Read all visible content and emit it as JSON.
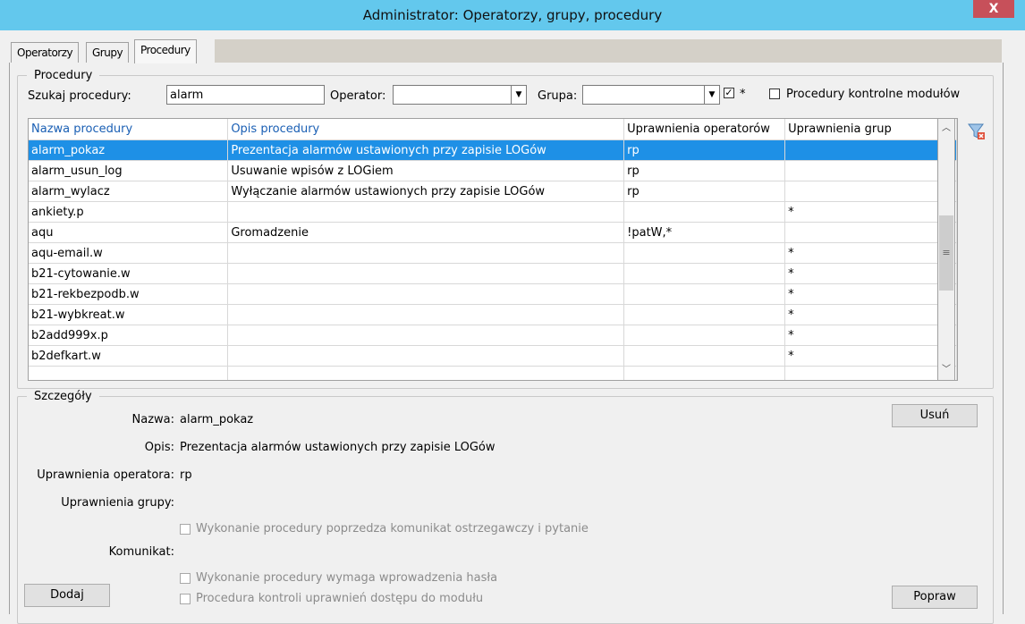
{
  "window": {
    "title": "Administrator: Operatorzy, grupy, procedury",
    "close_label": "X"
  },
  "tabs": [
    {
      "label": "Operatorzy",
      "active": false
    },
    {
      "label": "Grupy",
      "active": false
    },
    {
      "label": "Procedury",
      "active": true
    }
  ],
  "procedures": {
    "legend": "Procedury",
    "search_label": "Szukaj procedury:",
    "search_value": "alarm",
    "operator_label": "Operator:",
    "operator_value": "",
    "group_label": "Grupa:",
    "group_value": "",
    "star_checkbox_checked": true,
    "star_label": "*",
    "control_checkbox_checked": false,
    "control_label": "Procedury kontrolne modułów",
    "columns": [
      "Nazwa procedury",
      "Opis procedury",
      "Uprawnienia operatorów",
      "Uprawnienia grup"
    ],
    "rows": [
      [
        "alarm_pokaz",
        "Prezentacja alarmów ustawionych przy zapisie LOGów",
        "rp",
        ""
      ],
      [
        "alarm_usun_log",
        "Usuwanie wpisów z LOGiem",
        "rp",
        ""
      ],
      [
        "alarm_wylacz",
        "Wyłączanie alarmów ustawionych przy zapisie LOGów",
        "rp",
        ""
      ],
      [
        "ankiety.p",
        "",
        "",
        "*"
      ],
      [
        "aqu",
        "Gromadzenie",
        "!patW,*",
        ""
      ],
      [
        "aqu-email.w",
        "",
        "",
        "*"
      ],
      [
        "b21-cytowanie.w",
        "",
        "",
        "*"
      ],
      [
        "b21-rekbezpodb.w",
        "",
        "",
        "*"
      ],
      [
        "b21-wybkreat.w",
        "",
        "",
        "*"
      ],
      [
        "b2add999x.p",
        "",
        "",
        "*"
      ],
      [
        "b2defkart.w",
        "",
        "",
        "*"
      ],
      [
        "",
        "",
        "",
        ""
      ]
    ],
    "selected_row": 0
  },
  "details": {
    "legend": "Szczegóły",
    "name_label": "Nazwa:",
    "name_value": "alarm_pokaz",
    "desc_label": "Opis:",
    "desc_value": "Prezentacja alarmów ustawionych przy zapisie LOGów",
    "op_rights_label": "Uprawnienia operatora:",
    "op_rights_value": "rp",
    "group_rights_label": "Uprawnienia grupy:",
    "group_rights_value": "",
    "warn_check_label": "Wykonanie procedury poprzedza komunikat ostrzegawczy i pytanie",
    "message_label": "Komunikat:",
    "password_check_label": "Wykonanie procedury wymaga wprowadzenia hasła",
    "access_check_label": "Procedura kontroli uprawnień dostępu do modułu",
    "delete_button": "Usuń",
    "add_button": "Dodaj",
    "fix_button": "Popraw"
  },
  "icons": {
    "filter": "filter-clear-icon"
  },
  "colors": {
    "titlebar": "#63c8ed",
    "close": "#c7505a",
    "selection": "#1e90e6",
    "header_link": "#1a5fb4"
  }
}
